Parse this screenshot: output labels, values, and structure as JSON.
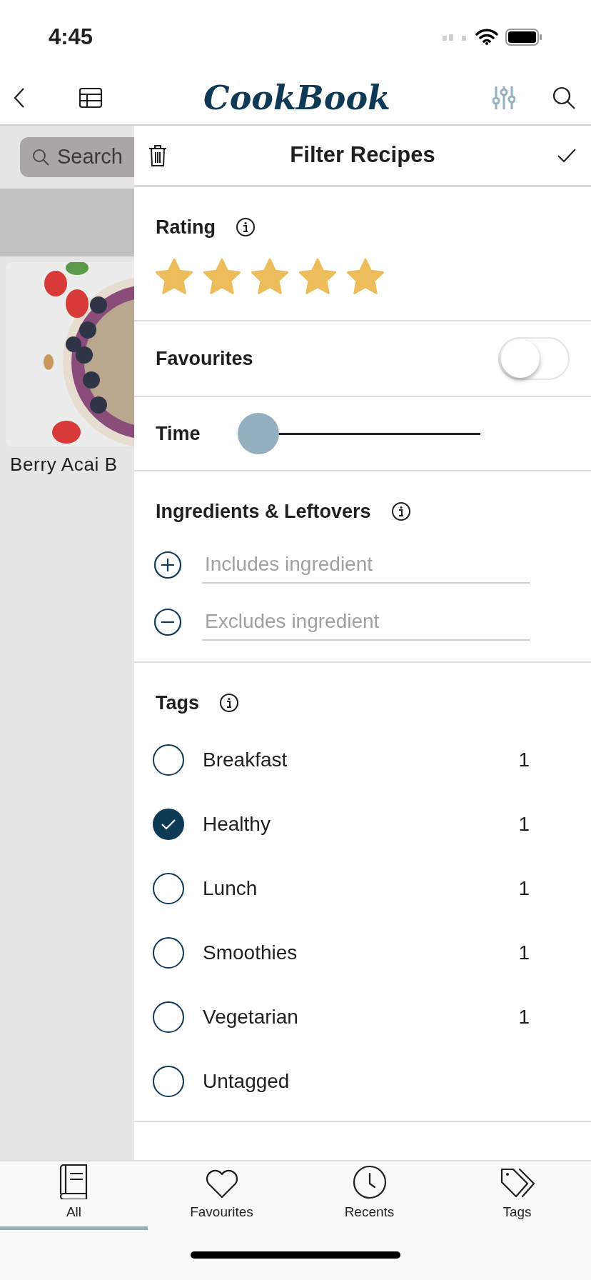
{
  "status_bar": {
    "time": "4:45"
  },
  "nav": {
    "logo": "CookBook"
  },
  "background": {
    "search_placeholder": "Search",
    "recipe_title": "Berry Acai B"
  },
  "filter_panel": {
    "title": "Filter Recipes",
    "rating": {
      "label": "Rating",
      "stars": 5
    },
    "favourites": {
      "label": "Favourites",
      "on": false
    },
    "time": {
      "label": "Time",
      "level": 0
    },
    "ingredients": {
      "label": "Ingredients & Leftovers",
      "includes_placeholder": "Includes ingredient",
      "excludes_placeholder": "Excludes ingredient"
    },
    "tags": {
      "label": "Tags",
      "items": [
        {
          "label": "Breakfast",
          "count": "1",
          "checked": false
        },
        {
          "label": "Healthy",
          "count": "1",
          "checked": true
        },
        {
          "label": "Lunch",
          "count": "1",
          "checked": false
        },
        {
          "label": "Smoothies",
          "count": "1",
          "checked": false
        },
        {
          "label": "Vegetarian",
          "count": "1",
          "checked": false
        },
        {
          "label": "Untagged",
          "checked": false
        }
      ]
    }
  },
  "tab_bar": [
    {
      "label": "All",
      "selected": true,
      "kind": "book"
    },
    {
      "label": "Favourites",
      "selected": false,
      "kind": "heart"
    },
    {
      "label": "Recents",
      "selected": false,
      "kind": "clock"
    },
    {
      "label": "Tags",
      "selected": false,
      "kind": "tags"
    }
  ]
}
